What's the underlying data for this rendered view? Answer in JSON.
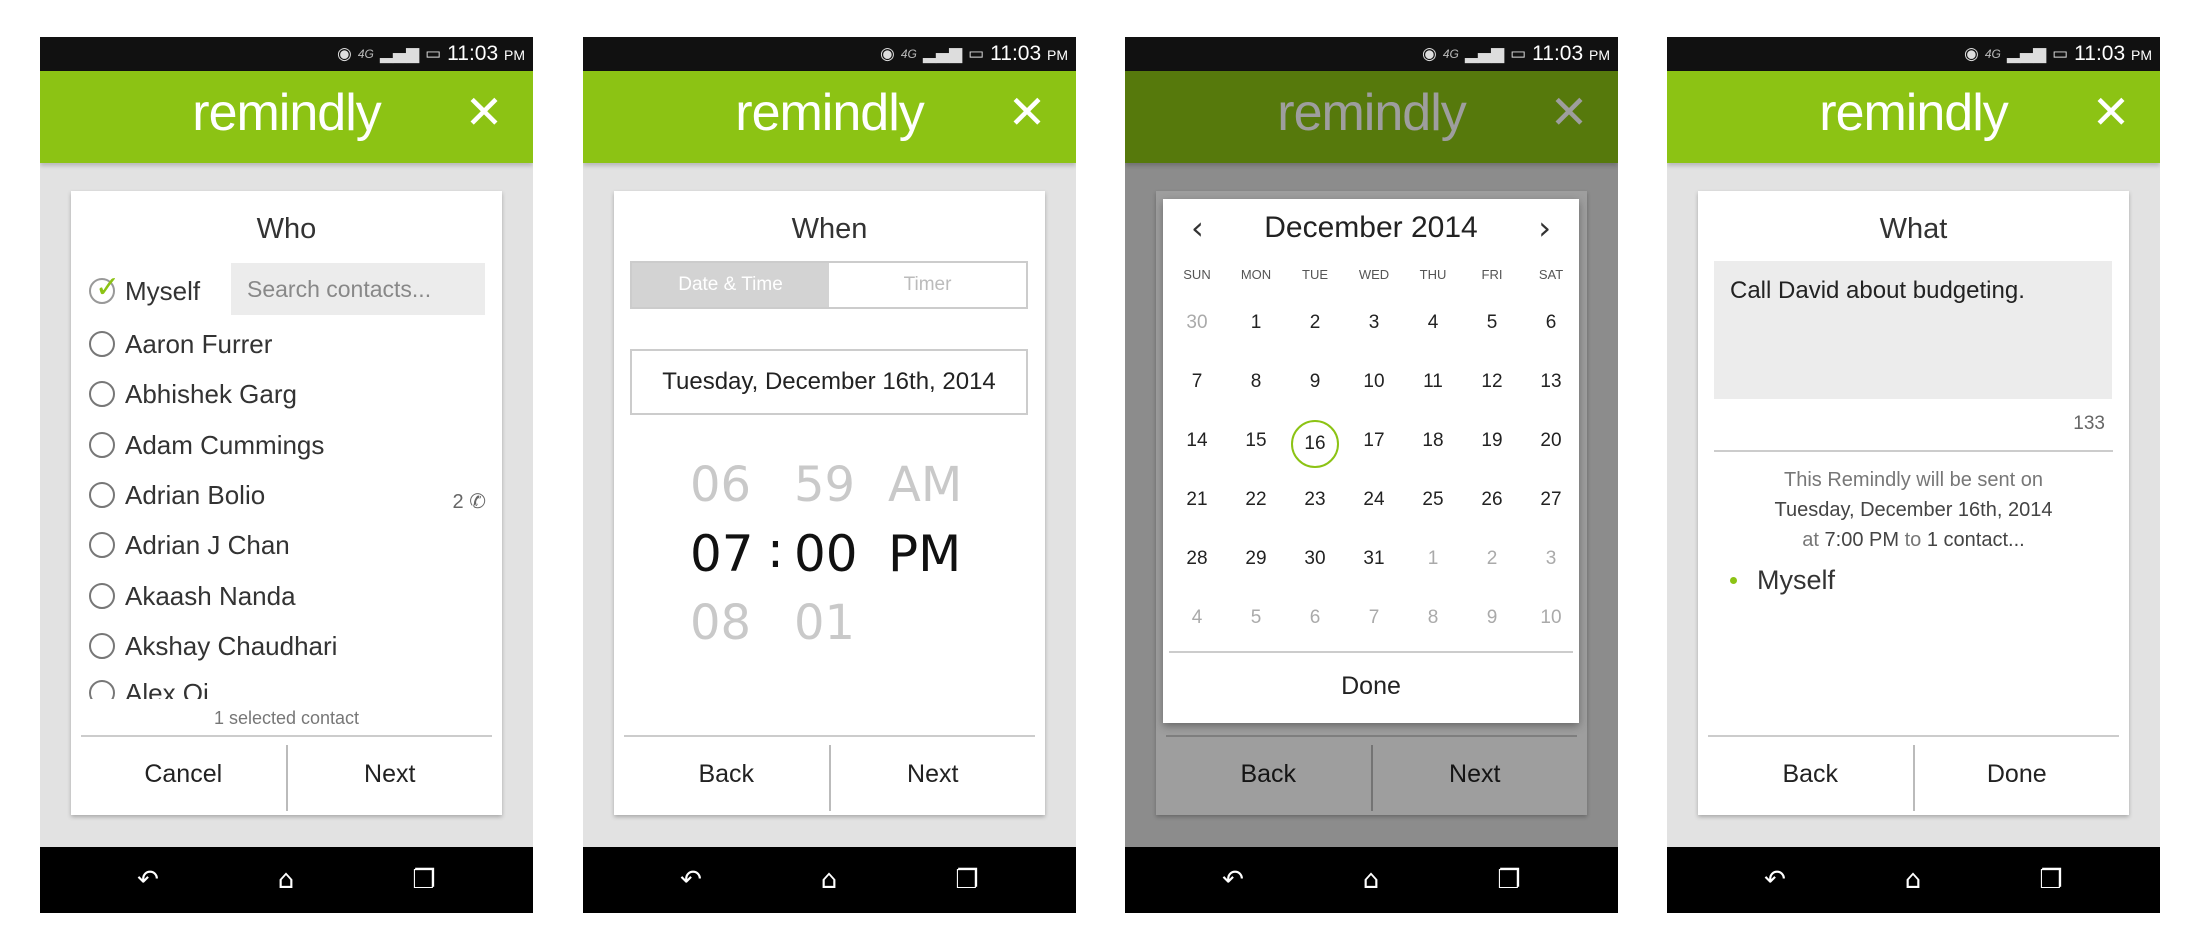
{
  "status": {
    "network": "4G",
    "time": "11:03",
    "ampm": "PM"
  },
  "app": {
    "name": "remindly",
    "accent": "#8cc314"
  },
  "icons": {
    "close": "close-icon",
    "back": "back-nav-icon",
    "home": "home-nav-icon",
    "recents": "recents-nav-icon"
  },
  "screen1": {
    "title": "Who",
    "search_placeholder": "Search contacts...",
    "contacts": [
      {
        "name": "Myself",
        "selected": true
      },
      {
        "name": "Aaron Furrer"
      },
      {
        "name": "Abhishek Garg"
      },
      {
        "name": "Adam Cummings"
      },
      {
        "name": "Adrian Bolio",
        "badge": "2"
      },
      {
        "name": "Adrian J Chan"
      },
      {
        "name": "Akaash Nanda"
      },
      {
        "name": "Akshay Chaudhari"
      },
      {
        "name": "Alex Qi"
      }
    ],
    "selected_count": "1 selected contact",
    "cancel": "Cancel",
    "next": "Next"
  },
  "screen2": {
    "title": "When",
    "tab_datetime": "Date & Time",
    "tab_timer": "Timer",
    "date": "Tuesday, December 16th, 2014",
    "picker": {
      "hour_prev": "06",
      "min_prev": "59",
      "ampm_prev": "AM",
      "hour": "07",
      "sep": ":",
      "min": "00",
      "ampm": "PM",
      "hour_next": "08",
      "min_next": "01"
    },
    "back": "Back",
    "next": "Next"
  },
  "screen3": {
    "month": "December 2014",
    "weekdays": [
      "SUN",
      "MON",
      "TUE",
      "WED",
      "THU",
      "FRI",
      "SAT"
    ],
    "weeks": [
      [
        "30",
        "1",
        "2",
        "3",
        "4",
        "5",
        "6"
      ],
      [
        "7",
        "8",
        "9",
        "10",
        "11",
        "12",
        "13"
      ],
      [
        "14",
        "15",
        "16",
        "17",
        "18",
        "19",
        "20"
      ],
      [
        "21",
        "22",
        "23",
        "24",
        "25",
        "26",
        "27"
      ],
      [
        "28",
        "29",
        "30",
        "31",
        "1",
        "2",
        "3"
      ],
      [
        "4",
        "5",
        "6",
        "7",
        "8",
        "9",
        "10"
      ]
    ],
    "selected_day": "16",
    "done": "Done",
    "back": "Back",
    "next": "Next"
  },
  "screen4": {
    "title": "What",
    "message": "Call David about budgeting.",
    "char_count": "133",
    "summary_line1": "This Remindly will be sent on",
    "summary_date": "Tuesday, December 16th, 2014",
    "summary_at": "at",
    "summary_time": "7:00 PM",
    "summary_to": "to",
    "summary_contacts": "1 contact...",
    "recipient": "Myself",
    "back": "Back",
    "done": "Done"
  }
}
